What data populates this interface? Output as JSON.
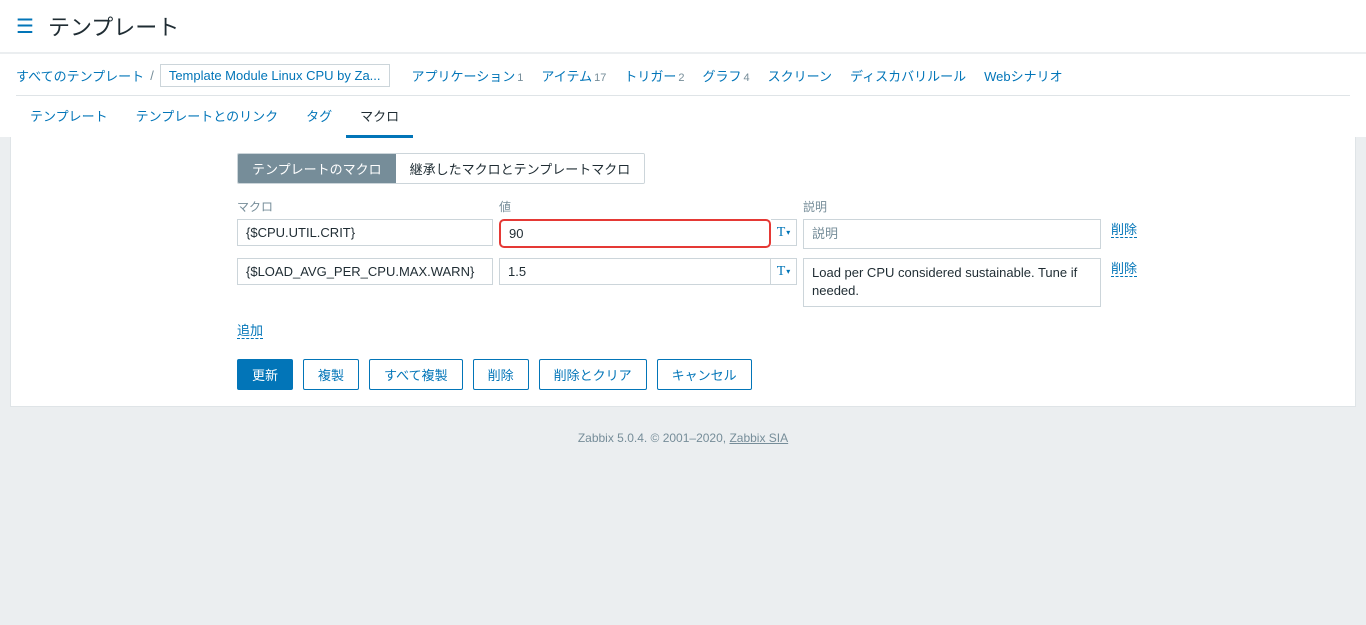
{
  "pageTitle": "テンプレート",
  "breadcrumb": {
    "allTemplates": "すべてのテンプレート",
    "current": "Template Module Linux CPU by Za..."
  },
  "topMenu": [
    {
      "label": "アプリケーション",
      "count": "1"
    },
    {
      "label": "アイテム",
      "count": "17"
    },
    {
      "label": "トリガー",
      "count": "2"
    },
    {
      "label": "グラフ",
      "count": "4"
    },
    {
      "label": "スクリーン",
      "count": ""
    },
    {
      "label": "ディスカバリルール",
      "count": ""
    },
    {
      "label": "Webシナリオ",
      "count": ""
    }
  ],
  "tabs": [
    {
      "label": "テンプレート",
      "active": false
    },
    {
      "label": "テンプレートとのリンク",
      "active": false
    },
    {
      "label": "タグ",
      "active": false
    },
    {
      "label": "マクロ",
      "active": true
    }
  ],
  "toggle": {
    "templateMacros": "テンプレートのマクロ",
    "inherited": "継承したマクロとテンプレートマクロ"
  },
  "columns": {
    "macro": "マクロ",
    "value": "値",
    "description": "説明"
  },
  "macros": [
    {
      "name": "{$CPU.UTIL.CRIT}",
      "value": "90",
      "description": "",
      "highlighted": true
    },
    {
      "name": "{$LOAD_AVG_PER_CPU.MAX.WARN}",
      "value": "1.5",
      "description": "Load per CPU considered sustainable. Tune if needed.",
      "highlighted": false
    }
  ],
  "descPlaceholder": "説明",
  "actions": {
    "delete": "削除",
    "add": "追加"
  },
  "buttons": {
    "update": "更新",
    "clone": "複製",
    "fullClone": "すべて複製",
    "delete": "削除",
    "deleteClear": "削除とクリア",
    "cancel": "キャンセル"
  },
  "footer": {
    "prefix": "Zabbix 5.0.4. © 2001–2020, ",
    "link": "Zabbix SIA"
  }
}
